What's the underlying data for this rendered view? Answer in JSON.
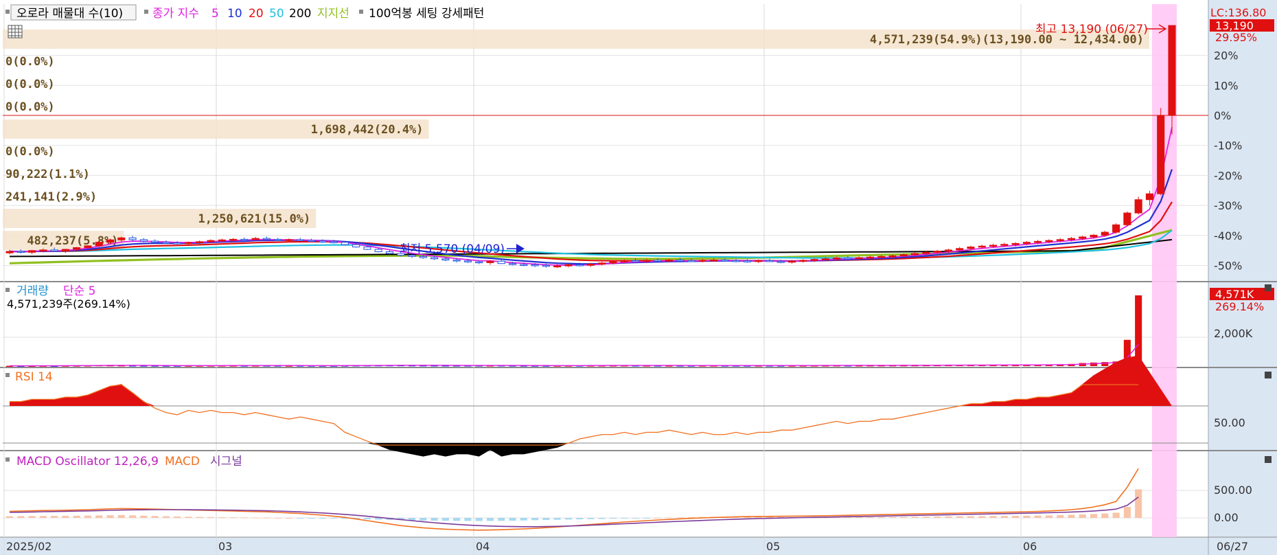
{
  "legend_main": {
    "title": "오로라 매물대 수(10)",
    "ma_label": "종가 지수",
    "ma_periods": [
      "5",
      "10",
      "20",
      "50",
      "200"
    ],
    "ma_colors": [
      "#e020e0",
      "#2030d0",
      "#e01010",
      "#20c0e0",
      "#000000"
    ],
    "support_label": "지지선",
    "support_color": "#90c020",
    "setting_label": "100억봉 세팅 강세패턴"
  },
  "lc_label": "LC:136.80",
  "price_tag": "13,190",
  "price_pct_tag": "29.95%",
  "high_label": "최고 13,190 (06/27)",
  "low_label": "최저 5,570 (04/09)",
  "pct_ticks": [
    "20%",
    "10%",
    "0%",
    "-10%",
    "-20%",
    "-30%",
    "-40%",
    "-50%"
  ],
  "volume_profile": [
    {
      "label": "4,571,239(54.9%)(13,190.00 ~ 12,434.00)",
      "bar": true,
      "share": 0.549
    },
    {
      "label": "0(0.0%)",
      "bar": false
    },
    {
      "label": "0(0.0%)",
      "bar": false
    },
    {
      "label": "0(0.0%)",
      "bar": false
    },
    {
      "label": "1,698,442(20.4%)",
      "bar": true,
      "share": 0.204
    },
    {
      "label": "0(0.0%)",
      "bar": false
    },
    {
      "label": "90,222(1.1%)",
      "bar": false
    },
    {
      "label": "241,141(2.9%)",
      "bar": false
    },
    {
      "label": "1,250,621(15.0%)",
      "bar": true,
      "share": 0.15
    },
    {
      "label": "482,237(5.8%)",
      "bar": true,
      "share": 0.058
    }
  ],
  "volume_panel": {
    "title": "거래량",
    "ma_label": "단순 5",
    "info": "4,571,239주(269.14%)",
    "tag": "4,571K",
    "tag_pct": "269.14%",
    "tick": "2,000K"
  },
  "rsi_panel": {
    "title": "RSI 14",
    "tick": "50.00"
  },
  "macd_panel": {
    "title": "MACD Oscillator 12,26,9",
    "macd_label": "MACD",
    "signal_label": "시그널",
    "ticks": [
      "500.00",
      "0.00"
    ]
  },
  "x_axis": {
    "labels": [
      "2025/02",
      "03",
      "04",
      "05",
      "06"
    ],
    "last_label": "06/27"
  },
  "chart_data": {
    "type": "candlestick",
    "price_axis_percent_range": [
      -55,
      30
    ],
    "x_label_indices": [
      0,
      19,
      42,
      68,
      91
    ],
    "candles": [
      [
        5500,
        5600,
        5450,
        5550
      ],
      [
        5550,
        5620,
        5480,
        5520
      ],
      [
        5520,
        5600,
        5460,
        5580
      ],
      [
        5580,
        5650,
        5520,
        5600
      ],
      [
        5600,
        5680,
        5540,
        5560
      ],
      [
        5560,
        5640,
        5500,
        5620
      ],
      [
        5620,
        5700,
        5580,
        5680
      ],
      [
        5680,
        5760,
        5640,
        5740
      ],
      [
        5740,
        5900,
        5700,
        5860
      ],
      [
        5860,
        5980,
        5800,
        5940
      ],
      [
        5940,
        6050,
        5880,
        6010
      ],
      [
        6010,
        6080,
        5900,
        5950
      ],
      [
        5950,
        6000,
        5860,
        5900
      ],
      [
        5900,
        5960,
        5820,
        5860
      ],
      [
        5860,
        5920,
        5800,
        5840
      ],
      [
        5840,
        5900,
        5780,
        5820
      ],
      [
        5820,
        5880,
        5760,
        5850
      ],
      [
        5850,
        5920,
        5800,
        5880
      ],
      [
        5880,
        5960,
        5840,
        5920
      ],
      [
        5920,
        5980,
        5860,
        5940
      ],
      [
        5940,
        6000,
        5880,
        5960
      ],
      [
        5960,
        6020,
        5900,
        5950
      ],
      [
        5950,
        6040,
        5900,
        5990
      ],
      [
        5990,
        6050,
        5920,
        5960
      ],
      [
        5960,
        6010,
        5900,
        5930
      ],
      [
        5930,
        5990,
        5880,
        5950
      ],
      [
        5950,
        6010,
        5900,
        5920
      ],
      [
        5920,
        5980,
        5860,
        5900
      ],
      [
        5900,
        5960,
        5840,
        5880
      ],
      [
        5880,
        5940,
        5820,
        5860
      ],
      [
        5860,
        5900,
        5760,
        5780
      ],
      [
        5780,
        5820,
        5680,
        5700
      ],
      [
        5700,
        5740,
        5600,
        5620
      ],
      [
        5620,
        5660,
        5520,
        5540
      ],
      [
        5540,
        5600,
        5450,
        5480
      ],
      [
        5480,
        5540,
        5380,
        5420
      ],
      [
        5420,
        5480,
        5330,
        5380
      ],
      [
        5380,
        5440,
        5300,
        5340
      ],
      [
        5340,
        5400,
        5260,
        5300
      ],
      [
        5300,
        5360,
        5220,
        5260
      ],
      [
        5260,
        5320,
        5180,
        5230
      ],
      [
        5230,
        5300,
        5160,
        5200
      ],
      [
        5200,
        5260,
        5120,
        5170
      ],
      [
        5170,
        5240,
        5100,
        5220
      ],
      [
        5220,
        5300,
        5150,
        5140
      ],
      [
        5140,
        5200,
        5080,
        5110
      ],
      [
        5110,
        5180,
        5050,
        5100
      ],
      [
        5100,
        5160,
        5020,
        5080
      ],
      [
        5080,
        5140,
        5000,
        5050
      ],
      [
        5050,
        5120,
        4990,
        5060
      ],
      [
        5060,
        5140,
        5010,
        5100
      ],
      [
        5100,
        5170,
        5040,
        5080
      ],
      [
        5080,
        5160,
        5030,
        5120
      ],
      [
        5120,
        5200,
        5080,
        5160
      ],
      [
        5160,
        5230,
        5110,
        5200
      ],
      [
        5200,
        5280,
        5160,
        5240
      ],
      [
        5240,
        5320,
        5200,
        5220
      ],
      [
        5220,
        5300,
        5160,
        5250
      ],
      [
        5250,
        5320,
        5200,
        5230
      ],
      [
        5230,
        5300,
        5180,
        5260
      ],
      [
        5260,
        5330,
        5210,
        5240
      ],
      [
        5240,
        5310,
        5190,
        5230
      ],
      [
        5230,
        5300,
        5180,
        5250
      ],
      [
        5250,
        5320,
        5200,
        5260
      ],
      [
        5260,
        5320,
        5200,
        5240
      ],
      [
        5240,
        5300,
        5180,
        5230
      ],
      [
        5230,
        5290,
        5170,
        5220
      ],
      [
        5220,
        5280,
        5160,
        5240
      ],
      [
        5240,
        5300,
        5190,
        5210
      ],
      [
        5210,
        5270,
        5150,
        5200
      ],
      [
        5200,
        5260,
        5140,
        5220
      ],
      [
        5220,
        5290,
        5170,
        5250
      ],
      [
        5250,
        5320,
        5200,
        5280
      ],
      [
        5280,
        5350,
        5230,
        5300
      ],
      [
        5300,
        5370,
        5250,
        5330
      ],
      [
        5330,
        5400,
        5280,
        5310
      ],
      [
        5310,
        5380,
        5260,
        5340
      ],
      [
        5340,
        5410,
        5290,
        5360
      ],
      [
        5360,
        5430,
        5310,
        5380
      ],
      [
        5380,
        5450,
        5330,
        5400
      ],
      [
        5400,
        5480,
        5350,
        5440
      ],
      [
        5440,
        5520,
        5390,
        5480
      ],
      [
        5480,
        5560,
        5430,
        5520
      ],
      [
        5520,
        5600,
        5470,
        5560
      ],
      [
        5560,
        5640,
        5500,
        5600
      ],
      [
        5600,
        5700,
        5540,
        5650
      ],
      [
        5650,
        5740,
        5590,
        5700
      ],
      [
        5700,
        5780,
        5640,
        5730
      ],
      [
        5730,
        5810,
        5670,
        5760
      ],
      [
        5760,
        5840,
        5700,
        5790
      ],
      [
        5790,
        5860,
        5720,
        5820
      ],
      [
        5820,
        5900,
        5760,
        5860
      ],
      [
        5860,
        5940,
        5800,
        5890
      ],
      [
        5890,
        5960,
        5830,
        5920
      ],
      [
        5920,
        6000,
        5860,
        5950
      ],
      [
        5950,
        6040,
        5890,
        5990
      ],
      [
        5990,
        6080,
        5930,
        6040
      ],
      [
        6040,
        6140,
        5980,
        6100
      ],
      [
        6100,
        6250,
        6050,
        6200
      ],
      [
        6200,
        6500,
        6150,
        6450
      ],
      [
        6450,
        6900,
        6400,
        6850
      ],
      [
        6850,
        7400,
        6800,
        7300
      ],
      [
        7300,
        7600,
        7100,
        7500
      ],
      [
        7500,
        10400,
        7450,
        10150
      ],
      [
        10150,
        13190,
        9500,
        13190
      ]
    ],
    "volume": [
      20000,
      18000,
      25000,
      30000,
      22000,
      35000,
      40000,
      45000,
      60000,
      55000,
      50000,
      42000,
      38000,
      36000,
      34000,
      33000,
      35000,
      37000,
      40000,
      42000,
      41000,
      39000,
      43000,
      40000,
      38000,
      36000,
      37000,
      35000,
      34000,
      33000,
      40000,
      48000,
      52000,
      55000,
      58000,
      60000,
      54000,
      50000,
      47000,
      45000,
      43000,
      42000,
      44000,
      46000,
      48000,
      40000,
      38000,
      36000,
      35000,
      37000,
      39000,
      41000,
      43000,
      45000,
      47000,
      49000,
      46000,
      44000,
      42000,
      41000,
      40000,
      39000,
      42000,
      43000,
      41000,
      40000,
      39000,
      41000,
      40000,
      38000,
      39000,
      42000,
      45000,
      47000,
      50000,
      46000,
      48000,
      50000,
      52000,
      54000,
      56000,
      60000,
      62000,
      64000,
      66000,
      68000,
      70000,
      72000,
      75000,
      78000,
      80000,
      84000,
      88000,
      95000,
      110000,
      140000,
      200000,
      230000,
      260000,
      300000,
      1698442,
      4571239
    ],
    "rsi": [
      62,
      62,
      63,
      63,
      63,
      64,
      64,
      65,
      67,
      69,
      70,
      66,
      62,
      59,
      57,
      56,
      58,
      57,
      58,
      57,
      57,
      56,
      57,
      56,
      55,
      54,
      55,
      54,
      53,
      52,
      48,
      46,
      44,
      42,
      40,
      39,
      38,
      37,
      38,
      37,
      38,
      38,
      37,
      40,
      37,
      38,
      38,
      39,
      40,
      41,
      43,
      45,
      46,
      47,
      47,
      48,
      47,
      48,
      48,
      49,
      48,
      47,
      48,
      47,
      47,
      48,
      47,
      48,
      48,
      49,
      49,
      50,
      51,
      52,
      53,
      52,
      53,
      53,
      54,
      54,
      55,
      56,
      57,
      58,
      59,
      60,
      61,
      61,
      62,
      62,
      63,
      63,
      64,
      64,
      65,
      66,
      70,
      74,
      77,
      80,
      82,
      83
    ],
    "macd_osc": [
      30,
      32,
      34,
      35,
      36,
      38,
      40,
      42,
      45,
      48,
      50,
      45,
      40,
      35,
      30,
      26,
      22,
      18,
      15,
      12,
      10,
      8,
      6,
      4,
      2,
      0,
      -2,
      -4,
      -6,
      -10,
      -15,
      -20,
      -25,
      -30,
      -35,
      -40,
      -44,
      -48,
      -50,
      -52,
      -54,
      -55,
      -56,
      -55,
      -53,
      -50,
      -46,
      -42,
      -38,
      -34,
      -30,
      -26,
      -22,
      -18,
      -14,
      -10,
      -6,
      -2,
      2,
      6,
      10,
      14,
      18,
      20,
      22,
      24,
      22,
      20,
      18,
      16,
      14,
      12,
      10,
      11,
      12,
      13,
      14,
      15,
      16,
      17,
      18,
      20,
      22,
      24,
      26,
      28,
      30,
      32,
      34,
      36,
      38,
      40,
      42,
      45,
      50,
      56,
      62,
      70,
      80,
      95,
      200,
      520
    ],
    "macd_line": [
      120,
      125,
      130,
      135,
      138,
      140,
      145,
      150,
      158,
      165,
      170,
      168,
      165,
      160,
      155,
      150,
      145,
      140,
      135,
      130,
      125,
      120,
      115,
      110,
      100,
      90,
      80,
      65,
      50,
      30,
      10,
      -20,
      -50,
      -80,
      -110,
      -140,
      -160,
      -180,
      -195,
      -205,
      -212,
      -218,
      -222,
      -220,
      -215,
      -208,
      -200,
      -190,
      -178,
      -165,
      -150,
      -135,
      -120,
      -105,
      -90,
      -75,
      -62,
      -50,
      -38,
      -28,
      -18,
      -8,
      0,
      8,
      14,
      20,
      24,
      26,
      28,
      30,
      32,
      34,
      36,
      40,
      44,
      48,
      52,
      56,
      60,
      64,
      68,
      72,
      76,
      80,
      84,
      88,
      92,
      96,
      100,
      104,
      108,
      112,
      118,
      126,
      136,
      150,
      170,
      200,
      240,
      300,
      560,
      900
    ],
    "macd_signal": [
      100,
      104,
      108,
      112,
      116,
      120,
      124,
      128,
      133,
      138,
      143,
      146,
      148,
      150,
      150,
      150,
      149,
      148,
      146,
      144,
      141,
      138,
      134,
      130,
      125,
      118,
      110,
      100,
      90,
      78,
      64,
      48,
      30,
      10,
      -10,
      -30,
      -50,
      -70,
      -88,
      -104,
      -118,
      -130,
      -140,
      -148,
      -154,
      -158,
      -160,
      -160,
      -158,
      -154,
      -148,
      -141,
      -133,
      -124,
      -115,
      -106,
      -97,
      -88,
      -79,
      -70,
      -62,
      -54,
      -46,
      -38,
      -31,
      -24,
      -18,
      -12,
      -7,
      -2,
      2,
      6,
      10,
      14,
      18,
      22,
      26,
      30,
      34,
      38,
      42,
      46,
      50,
      54,
      58,
      62,
      66,
      70,
      74,
      78,
      82,
      86,
      90,
      95,
      100,
      107,
      115,
      126,
      140,
      160,
      230,
      380
    ]
  }
}
